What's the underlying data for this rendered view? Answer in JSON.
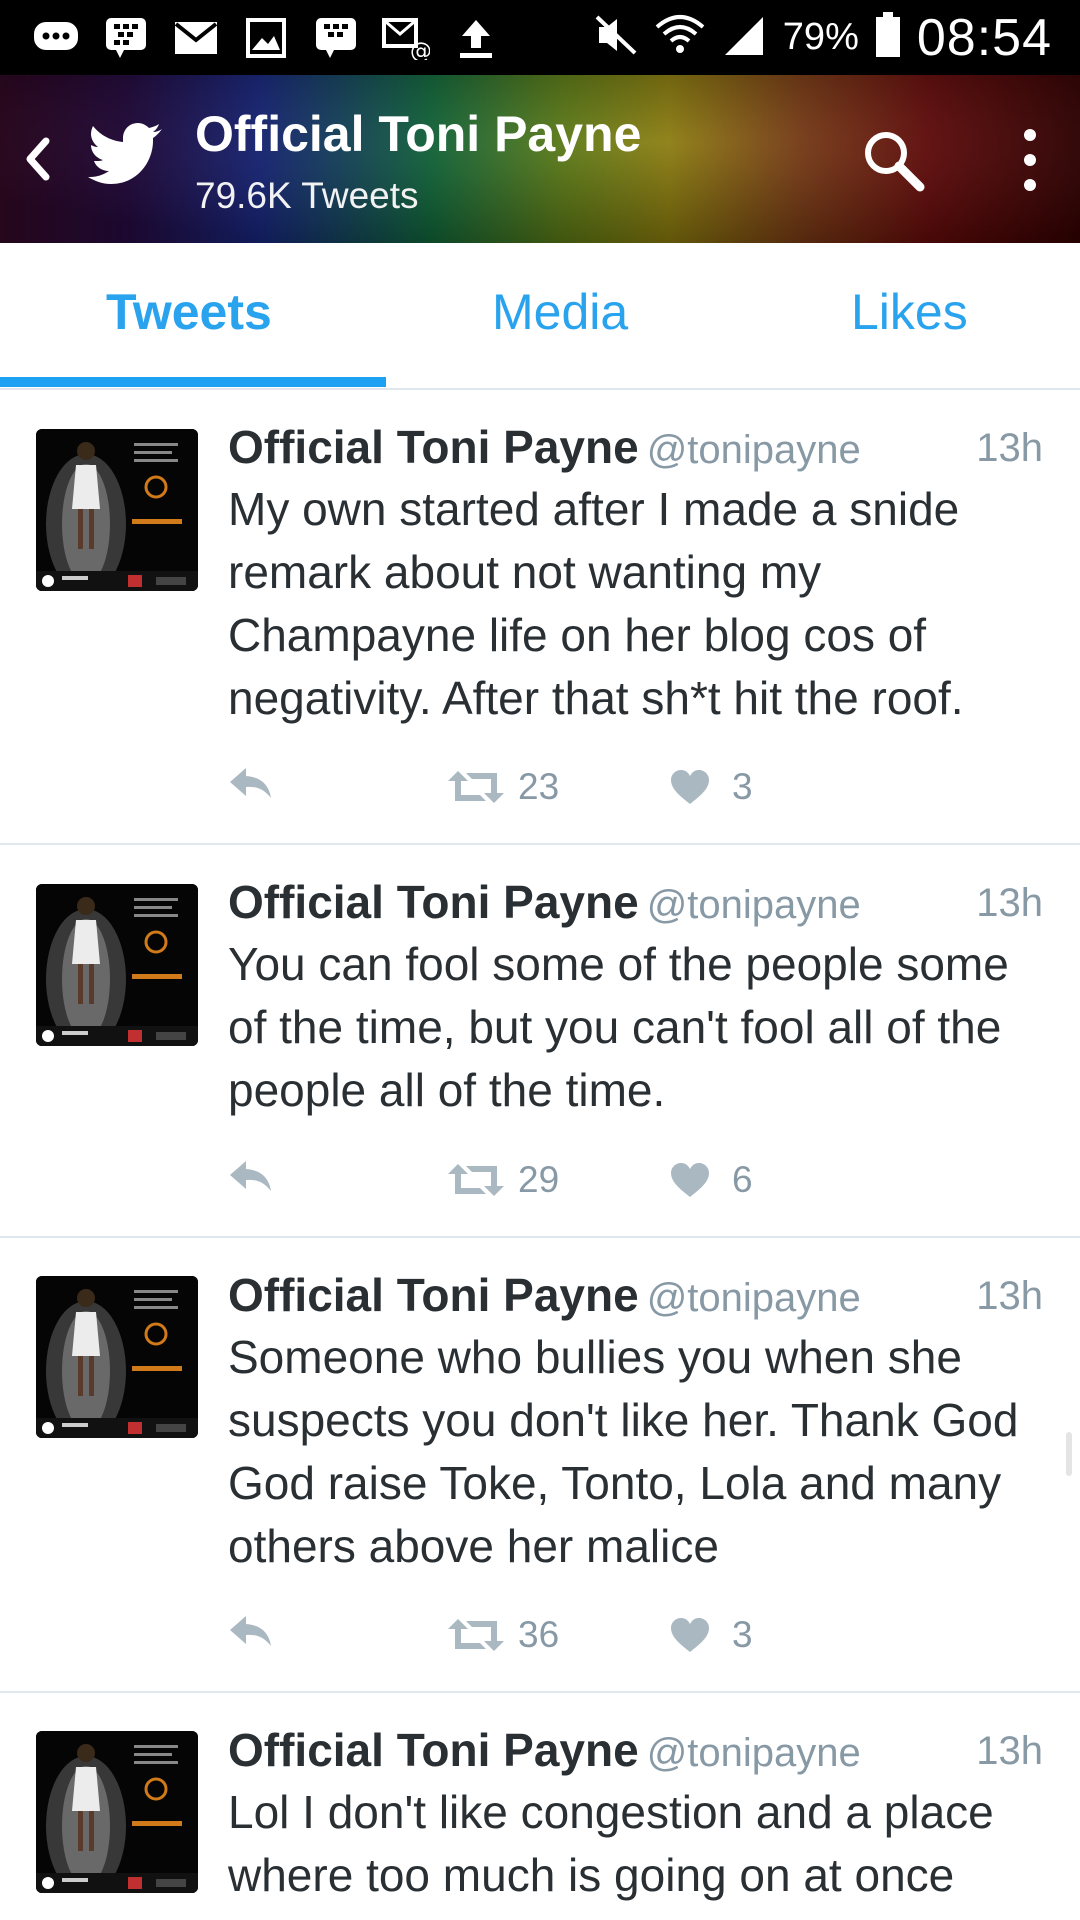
{
  "status_bar": {
    "icons": [
      "chat-icon",
      "bbm-icon",
      "mail-icon",
      "gallery-icon",
      "bbm-icon",
      "email-notify-icon",
      "upload-icon",
      "mute-icon",
      "wifi-icon",
      "signal-icon",
      "battery-icon"
    ],
    "battery": "79%",
    "time": "08:54"
  },
  "header": {
    "title": "Official Toni Payne",
    "subtitle": "79.6K Tweets"
  },
  "tabs": [
    {
      "label": "Tweets",
      "active": true
    },
    {
      "label": "Media",
      "active": false
    },
    {
      "label": "Likes",
      "active": false
    }
  ],
  "tweets": [
    {
      "name": "Official Toni Payne",
      "handle": "@tonipayne",
      "time": "13h",
      "text": "My own started after I made a snide remark about not wanting my Champayne life on her blog cos of negativity. After that sh*t hit the roof.",
      "retweets": "23",
      "likes": "3"
    },
    {
      "name": "Official Toni Payne",
      "handle": "@tonipayne",
      "time": "13h",
      "text": "You can fool some of the people some of the time, but you can't fool all of the people all of the time.",
      "retweets": "29",
      "likes": "6"
    },
    {
      "name": "Official Toni Payne",
      "handle": "@tonipayne",
      "time": "13h",
      "text": "Someone who bullies you when she suspects you don't like her. Thank God God raise Toke, Tonto, Lola and many others above her malice",
      "retweets": "36",
      "likes": "3"
    },
    {
      "name": "Official Toni Payne",
      "handle": "@tonipayne",
      "time": "13h",
      "text": "Lol I don't like congestion and a place where too much is going on at once"
    }
  ],
  "colors": {
    "accent": "#1da1f2",
    "text": "#292f33",
    "secondary": "#8899a6"
  }
}
